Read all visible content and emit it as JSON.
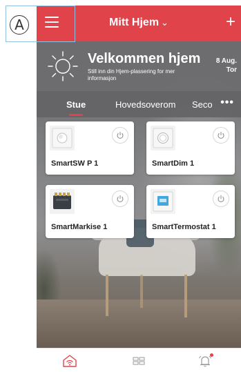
{
  "annotation": {
    "callout_label": "A"
  },
  "header": {
    "home_name": "Mitt Hjem",
    "chevron": "⌄",
    "add_label": "+",
    "accent_color": "#e0434a",
    "menu_icon": "hamburger-menu-icon"
  },
  "welcome": {
    "title": "Velkommen hjem",
    "subtitle": "Still inn din Hjem-plassering for mer informasjon",
    "date_line1": "8 Aug.",
    "date_line2": "Tor",
    "icon": "sun-icon"
  },
  "tabs": {
    "items": [
      {
        "label": "Stue",
        "active": true
      },
      {
        "label": "Hovedsoverom",
        "active": false
      },
      {
        "label": "Seco",
        "active": false
      }
    ],
    "more_label": "•••"
  },
  "devices": [
    {
      "name": "SmartSW P 1",
      "icon": "smart-switch-icon",
      "power_icon": "power-icon"
    },
    {
      "name": "SmartDim 1",
      "icon": "smart-dimmer-icon",
      "power_icon": "power-icon"
    },
    {
      "name": "SmartMarkise 1",
      "icon": "smart-awning-module-icon",
      "power_icon": "power-icon"
    },
    {
      "name": "SmartTermostat 1",
      "icon": "smart-thermostat-icon",
      "power_icon": "power-icon"
    }
  ],
  "bottom_nav": {
    "items": [
      {
        "icon": "home-wifi-icon",
        "active": true
      },
      {
        "icon": "grid-view-icon",
        "active": false
      },
      {
        "icon": "alarm-bell-icon",
        "active": false,
        "badge": true
      }
    ]
  }
}
